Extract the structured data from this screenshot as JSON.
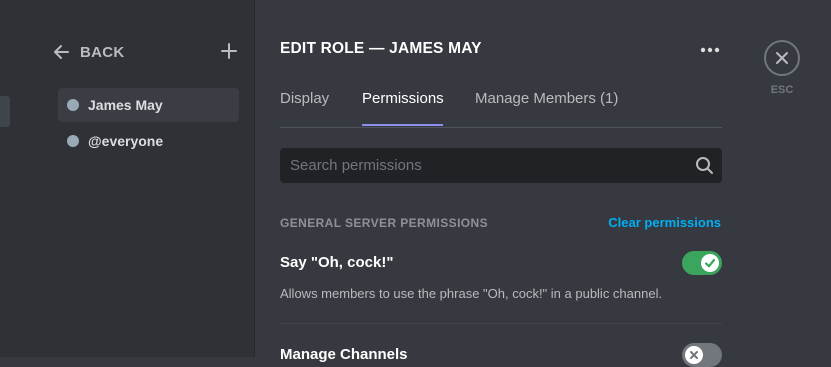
{
  "sidebar": {
    "back_label": "BACK",
    "roles": [
      {
        "label": "James May",
        "selected": true
      },
      {
        "label": "@everyone",
        "selected": false
      }
    ]
  },
  "header": {
    "title": "EDIT ROLE — JAMES MAY"
  },
  "tabs": [
    {
      "label": "Display",
      "active": false
    },
    {
      "label": "Permissions",
      "active": true
    },
    {
      "label": "Manage Members (1)",
      "active": false
    }
  ],
  "search": {
    "placeholder": "Search permissions",
    "value": ""
  },
  "section": {
    "title": "GENERAL SERVER PERMISSIONS",
    "clear_label": "Clear permissions"
  },
  "permissions": [
    {
      "name": "Say \"Oh, cock!\"",
      "description": "Allows members to use the phrase \"Oh, cock!\" in a public channel.",
      "enabled": true
    },
    {
      "name": "Manage Channels",
      "enabled": false
    }
  ],
  "close": {
    "label": "ESC"
  },
  "colors": {
    "toggle_on": "#3ba55d",
    "toggle_off": "#72767d",
    "link": "#00aff4",
    "tab_underline": "#8c8ff0"
  }
}
